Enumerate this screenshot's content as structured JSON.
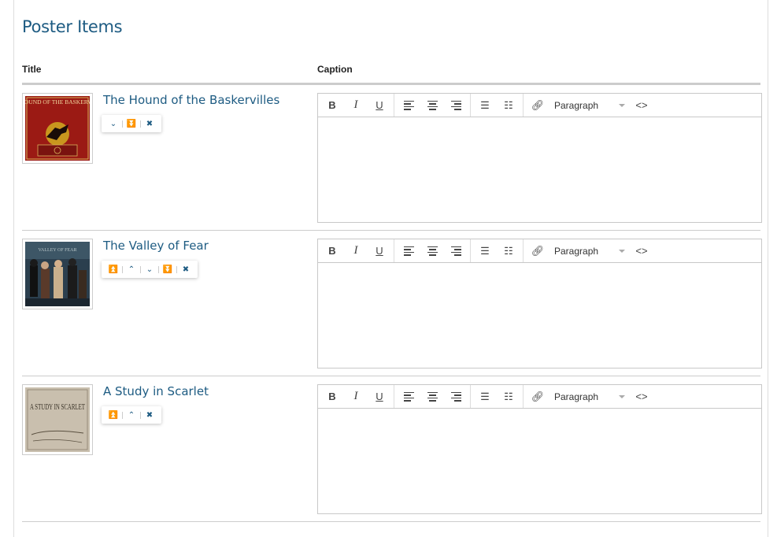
{
  "page": {
    "title": "Poster Items"
  },
  "columns": {
    "title": "Title",
    "caption": "Caption"
  },
  "editor": {
    "bold": "B",
    "italic": "I",
    "underline": "U",
    "format_label": "Paragraph",
    "source_label": "<>"
  },
  "items": [
    {
      "title": "The Hound of the Baskervilles",
      "controls": [
        "move-down",
        "move-to-bottom",
        "remove"
      ],
      "cover_text": "THE HOUND OF THE BASKERVILLES"
    },
    {
      "title": "The Valley of Fear",
      "controls": [
        "move-to-top",
        "move-up",
        "move-down",
        "move-to-bottom",
        "remove"
      ],
      "cover_text": "VALLEY OF FEAR"
    },
    {
      "title": "A Study in Scarlet",
      "controls": [
        "move-to-top",
        "move-up",
        "remove"
      ],
      "cover_text": "A STUDY IN SCARLET"
    }
  ],
  "colors": {
    "accent": "#1d5b82",
    "divider": "#cccccc"
  }
}
